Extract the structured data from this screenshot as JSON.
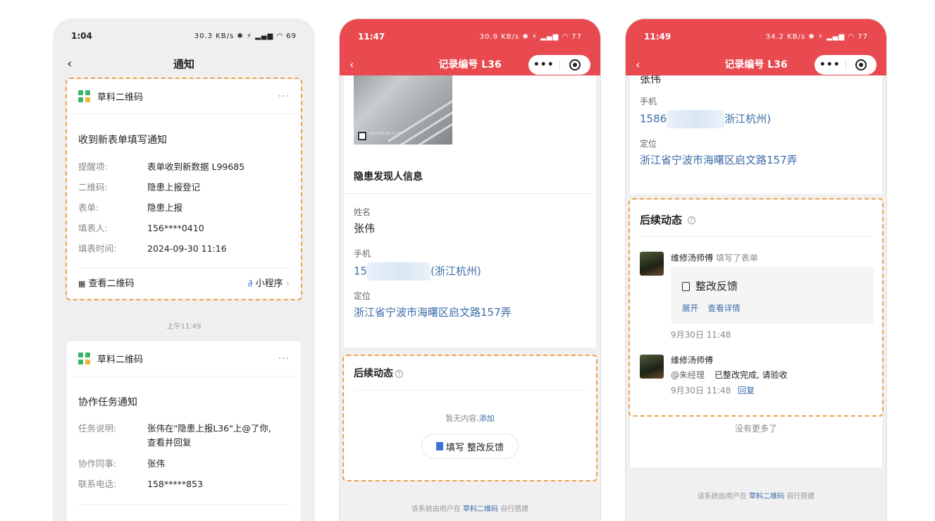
{
  "phone1": {
    "time": "1:04",
    "status_icons": "30.3 KB/s ✱ ⚡ ▂▄▆ ◠ 69",
    "nav_title": "通知",
    "card1": {
      "app_name": "草料二维码",
      "more": "···",
      "title": "收到新表单填写通知",
      "rows": [
        {
          "k": "提醒项:",
          "v": "表单收到新数据 L99685"
        },
        {
          "k": "二维码:",
          "v": "隐患上报登记"
        },
        {
          "k": "表单:",
          "v": "隐患上报"
        },
        {
          "k": "填表人:",
          "v": "156****0410"
        },
        {
          "k": "填表时间:",
          "v": "2024-09-30 11:16"
        }
      ],
      "view_qr": "查看二维码",
      "mini_program": "小程序"
    },
    "timestamp": "上午11:49",
    "card2": {
      "app_name": "草料二维码",
      "more": "···",
      "title": "协作任务通知",
      "rows": [
        {
          "k": "任务说明:",
          "v": "张伟在\"隐患上报L36\"上@了你,",
          "v2": "查看并回复"
        },
        {
          "k": "协作同事:",
          "v": "张伟"
        },
        {
          "k": "联系电话:",
          "v": "158*****853"
        }
      ]
    }
  },
  "phone2": {
    "time": "11:47",
    "status_icons": "30.9 KB/s ✱ ⚡ ▂▄▆ ◠ 77",
    "nav_title": "记录编号 L36",
    "capsule_more": "•••",
    "photo_caption": "2024-09-30 11:16",
    "section_title": "隐患发现人信息",
    "name_label": "姓名",
    "name_value": "张伟",
    "phone_label": "手机",
    "phone_prefix": "15",
    "phone_suffix": "(浙江杭州)",
    "loc_label": "定位",
    "loc_value": "浙江省宁波市海曙区启文路157弄",
    "followup_title": "后续动态",
    "empty_text": "暂无内容,",
    "add_link": "添加",
    "fill_button": "填写 整改反馈",
    "footer_pre": "该系统由用户在",
    "footer_brand": "草料二维码",
    "footer_post": "自行搭建"
  },
  "phone3": {
    "time": "11:49",
    "status_icons": "34.2 KB/s ✱ ⚡ ▂▄▆ ◠ 77",
    "nav_title": "记录编号 L36",
    "capsule_more": "•••",
    "cut_name": "张伟",
    "phone_label": "手机",
    "phone_prefix": "1586",
    "phone_suffix": "浙江杭州)",
    "loc_label": "定位",
    "loc_value": "浙江省宁波市海曙区启文路157弄",
    "followup_title": "后续动态",
    "entry1": {
      "user": "维修汤师傅",
      "action": "填写了表单",
      "form_title": "整改反馈",
      "expand": "展开",
      "details": "查看详情",
      "time": "9月30日 11:48"
    },
    "entry2": {
      "user": "维修汤师傅",
      "mention": "@朱经理",
      "message": "已整改完成, 请验收",
      "time": "9月30日 11:48",
      "reply": "回复"
    },
    "no_more": "没有更多了",
    "footer_pre": "该系统由用户在",
    "footer_brand": "草料二维码",
    "footer_post": "自行搭建"
  }
}
